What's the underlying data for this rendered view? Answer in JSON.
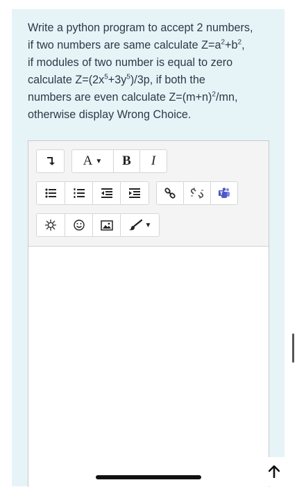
{
  "question": {
    "line1": "Write a python program to accept 2 numbers,",
    "line2_a": "if two numbers are same calculate Z=a",
    "line2_sup1": "2",
    "line2_b": "+b",
    "line2_sup2": "2",
    "line2_c": ",",
    "line3": "if modules of two number is equal to zero",
    "line4_a": "calculate Z=(2x",
    "line4_sup1": "5",
    "line4_b": "+3y",
    "line4_sup2": "5",
    "line4_c": ")/3p, if both the",
    "line5_a": "numbers are even calculate Z=(m+n)",
    "line5_sup": "2",
    "line5_b": "/mn,",
    "line6": "otherwise display Wrong Choice."
  },
  "toolbar": {
    "font_label": "A",
    "bold_label": "B",
    "italic_label": "I"
  },
  "colors": {
    "card_background": "#e6f4f8",
    "text": "#2d3a48",
    "teams_icon": "#5059c9"
  },
  "icons": {
    "collapse": "collapse-toolbar-icon",
    "font": "font-color-icon",
    "unordered_list": "unordered-list-icon",
    "ordered_list": "ordered-list-icon",
    "outdent": "outdent-icon",
    "indent": "indent-icon",
    "link": "link-icon",
    "unlink": "unlink-icon",
    "teams": "teams-meeting-icon",
    "special_char": "special-character-icon",
    "emoji": "emoji-icon",
    "image": "image-icon",
    "paintbrush": "paintbrush-icon",
    "scroll_top": "arrow-up-icon"
  }
}
